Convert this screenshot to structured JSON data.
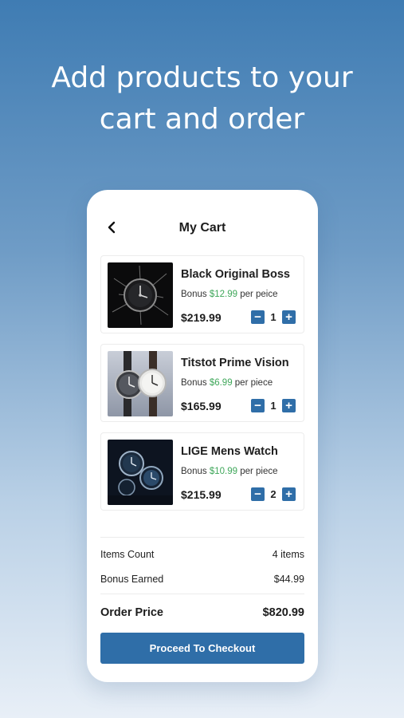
{
  "headline": {
    "line1": "Add products to your",
    "line2": "cart and order"
  },
  "header": {
    "title": "My Cart",
    "back_icon": "chevron-left-icon"
  },
  "cart_items": [
    {
      "name": "Black Original Boss",
      "bonus_prefix": "Bonus ",
      "bonus_amount": "$12.99",
      "bonus_suffix": " per peice",
      "price": "$219.99",
      "quantity": "1"
    },
    {
      "name": "Titstot Prime Vision",
      "bonus_prefix": "Bonus ",
      "bonus_amount": "$6.99",
      "bonus_suffix": " per piece",
      "price": "$165.99",
      "quantity": "1"
    },
    {
      "name": "LIGE Mens Watch",
      "bonus_prefix": "Bonus ",
      "bonus_amount": "$10.99",
      "bonus_suffix": " per piece",
      "price": "$215.99",
      "quantity": "2"
    }
  ],
  "stepper": {
    "minus": "−",
    "plus": "+"
  },
  "summary": {
    "items_count_label": "Items Count",
    "items_count_value": "4 items",
    "bonus_label": "Bonus Earned",
    "bonus_value": "$44.99",
    "order_label": "Order Price",
    "order_value": "$820.99"
  },
  "checkout_label": "Proceed To Checkout",
  "colors": {
    "accent": "#2f6ea8",
    "bonus": "#3fa75a"
  }
}
